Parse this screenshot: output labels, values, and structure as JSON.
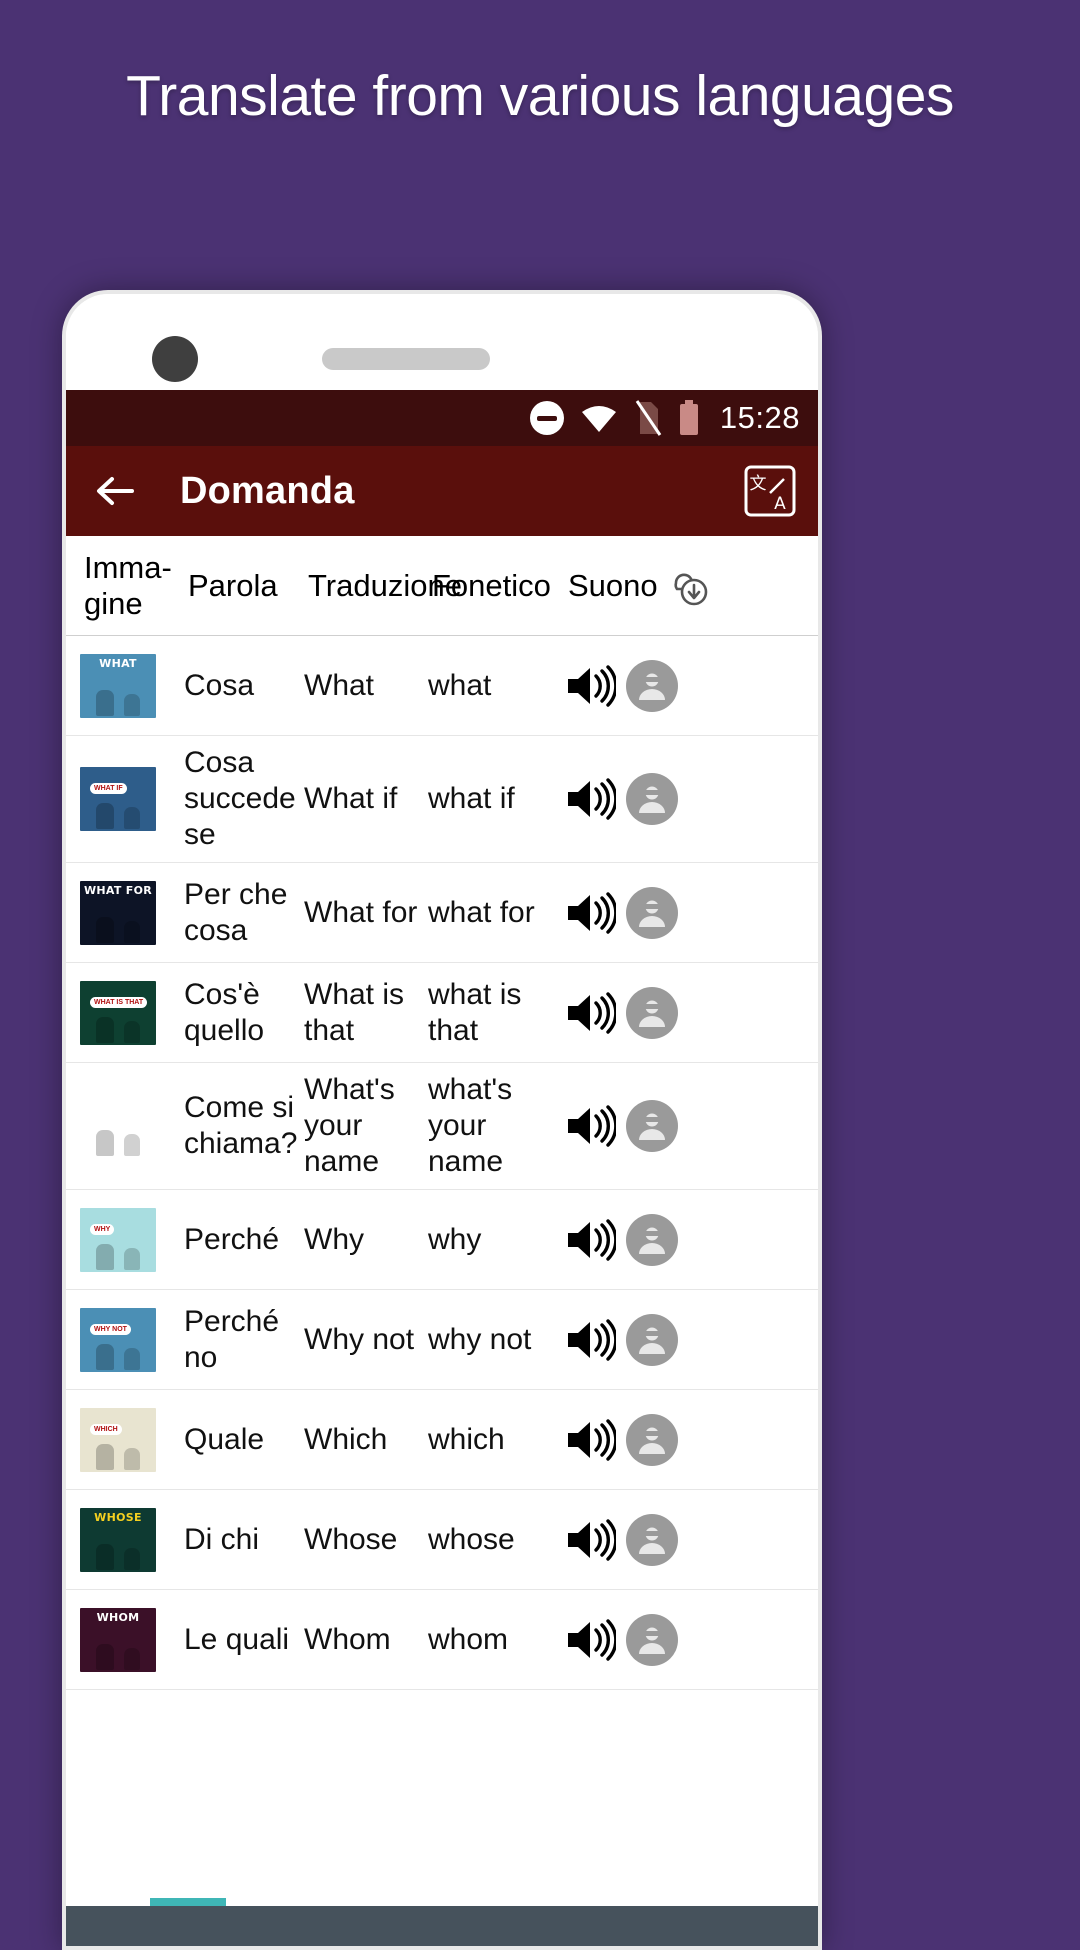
{
  "headline": "Translate from various languages",
  "theme": {
    "background": "#4b3273",
    "statusbar": "#3d0d0d",
    "appbar": "#5a0f0c",
    "accent": "#5a0f0c",
    "bottombar": "#46525c"
  },
  "statusbar": {
    "time": "15:28",
    "icons": [
      "do-not-disturb-icon",
      "wifi-icon",
      "sim-card-off-icon",
      "battery-icon"
    ]
  },
  "appbar": {
    "back_label": "back-arrow-icon",
    "title": "Domanda",
    "action_label": "translate-icon"
  },
  "table": {
    "headers": {
      "image": "Imma-gine",
      "word": "Parola",
      "translation": "Traduzione",
      "phonetic": "Fonetico",
      "sound": "Suono"
    },
    "download_label": "cloud-download-icon",
    "rows": [
      {
        "word": "Cosa",
        "translation": "What",
        "phonetic": "what",
        "thumb": {
          "label": "WHAT",
          "bg": "#4b8fb5",
          "label_color": "#ffffff",
          "bubble": ""
        }
      },
      {
        "word": "Cosa succede se",
        "translation": "What if",
        "phonetic": "what if",
        "thumb": {
          "label": "",
          "bg": "#2e5d8a",
          "label_color": "#ffffff",
          "bubble": "WHAT IF"
        }
      },
      {
        "word": "Per che cosa",
        "translation": "What for",
        "phonetic": "what for",
        "thumb": {
          "label": "WHAT FOR",
          "bg": "#0d1426",
          "label_color": "#ffffff",
          "bubble": ""
        }
      },
      {
        "word": "Cos'è quello",
        "translation": "What is that",
        "phonetic": "what is that",
        "thumb": {
          "label": "",
          "bg": "#0e4031",
          "label_color": "#ffffff",
          "bubble": "WHAT IS THAT"
        }
      },
      {
        "word": "Come si chiama?",
        "translation": "What's your name",
        "phonetic": "what's your name",
        "thumb": {
          "label": "",
          "bg": "#ffffff",
          "label_color": "#2b3aa0",
          "bubble": ""
        }
      },
      {
        "word": "Perché",
        "translation": "Why",
        "phonetic": "why",
        "thumb": {
          "label": "",
          "bg": "#a8dde0",
          "label_color": "#222222",
          "bubble": "WHY"
        }
      },
      {
        "word": "Perché no",
        "translation": "Why not",
        "phonetic": "why not",
        "thumb": {
          "label": "",
          "bg": "#4b8fb5",
          "label_color": "#222222",
          "bubble": "WHY NOT"
        }
      },
      {
        "word": "Quale",
        "translation": "Which",
        "phonetic": "which",
        "thumb": {
          "label": "",
          "bg": "#e8e4d0",
          "label_color": "#222222",
          "bubble": "WHICH"
        }
      },
      {
        "word": "Di chi",
        "translation": "Whose",
        "phonetic": "whose",
        "thumb": {
          "label": "WHOSE",
          "bg": "#0e3a32",
          "label_color": "#f5d020",
          "bubble": ""
        }
      },
      {
        "word": "Le quali",
        "translation": "Whom",
        "phonetic": "whom",
        "thumb": {
          "label": "WHOM",
          "bg": "#3b1028",
          "label_color": "#ffffff",
          "bubble": ""
        }
      }
    ],
    "row_icons": {
      "speaker": "speaker-icon",
      "avatar": "avatar-icon"
    }
  }
}
